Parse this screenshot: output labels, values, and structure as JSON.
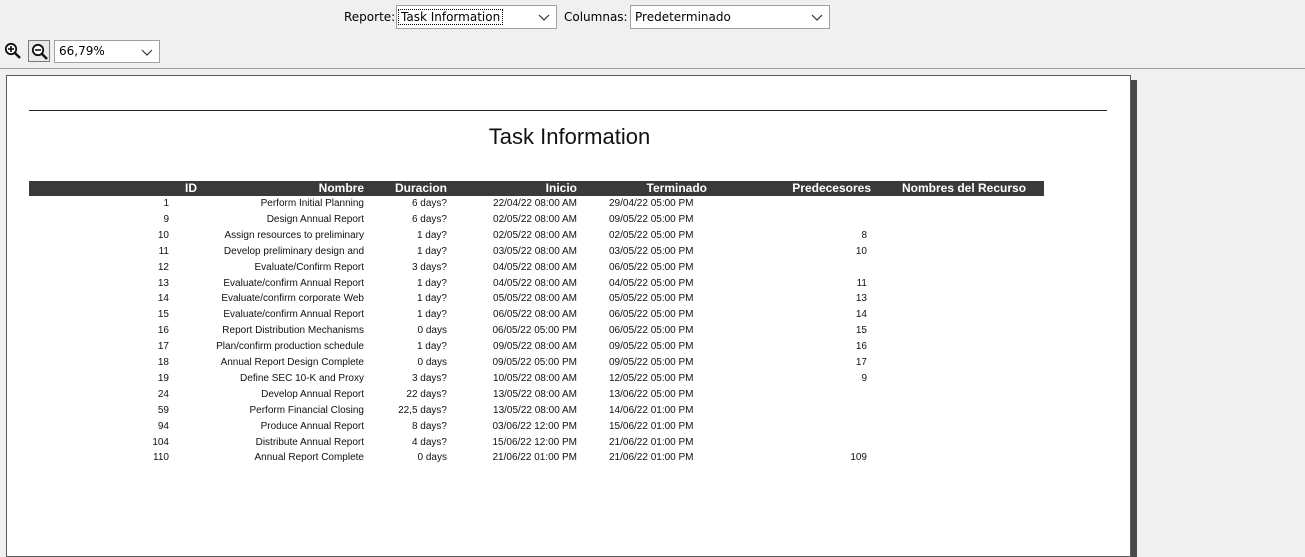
{
  "toolbar": {
    "report_label": "Reporte:",
    "report_value": "Task Information",
    "columns_label": "Columnas:",
    "columns_value": "Predeterminado",
    "zoom_value": "66,79%"
  },
  "report": {
    "title": "Task Information",
    "headers": {
      "id": "ID",
      "name": "Nombre",
      "duration": "Duracion",
      "start": "Inicio",
      "finish": "Terminado",
      "predecessors": "Predecesores",
      "resources": "Nombres del Recurso"
    },
    "rows": [
      {
        "id": "1",
        "name": "Perform Initial Planning",
        "duration": "6 days?",
        "start": "22/04/22 08:00 AM",
        "finish": "29/04/22 05:00 PM",
        "pred": ""
      },
      {
        "id": "9",
        "name": "Design Annual Report",
        "duration": "6 days?",
        "start": "02/05/22 08:00 AM",
        "finish": "09/05/22 05:00 PM",
        "pred": ""
      },
      {
        "id": "10",
        "name": "Assign resources to preliminary",
        "duration": "1 day?",
        "start": "02/05/22 08:00 AM",
        "finish": "02/05/22 05:00 PM",
        "pred": "8"
      },
      {
        "id": "11",
        "name": "Develop preliminary design and",
        "duration": "1 day?",
        "start": "03/05/22 08:00 AM",
        "finish": "03/05/22 05:00 PM",
        "pred": "10"
      },
      {
        "id": "12",
        "name": "Evaluate/Confirm Report",
        "duration": "3 days?",
        "start": "04/05/22 08:00 AM",
        "finish": "06/05/22 05:00 PM",
        "pred": ""
      },
      {
        "id": "13",
        "name": "Evaluate/confirm Annual Report",
        "duration": "1 day?",
        "start": "04/05/22 08:00 AM",
        "finish": "04/05/22 05:00 PM",
        "pred": "11"
      },
      {
        "id": "14",
        "name": "Evaluate/confirm corporate Web",
        "duration": "1 day?",
        "start": "05/05/22 08:00 AM",
        "finish": "05/05/22 05:00 PM",
        "pred": "13"
      },
      {
        "id": "15",
        "name": "Evaluate/confirm Annual Report",
        "duration": "1 day?",
        "start": "06/05/22 08:00 AM",
        "finish": "06/05/22 05:00 PM",
        "pred": "14"
      },
      {
        "id": "16",
        "name": "Report Distribution Mechanisms",
        "duration": "0 days",
        "start": "06/05/22 05:00 PM",
        "finish": "06/05/22 05:00 PM",
        "pred": "15"
      },
      {
        "id": "17",
        "name": "Plan/confirm production schedule",
        "duration": "1 day?",
        "start": "09/05/22 08:00 AM",
        "finish": "09/05/22 05:00 PM",
        "pred": "16"
      },
      {
        "id": "18",
        "name": "Annual Report Design Complete",
        "duration": "0 days",
        "start": "09/05/22 05:00 PM",
        "finish": "09/05/22 05:00 PM",
        "pred": "17"
      },
      {
        "id": "19",
        "name": "Define SEC 10-K and Proxy",
        "duration": "3 days?",
        "start": "10/05/22 08:00 AM",
        "finish": "12/05/22 05:00 PM",
        "pred": "9"
      },
      {
        "id": "24",
        "name": "Develop Annual Report",
        "duration": "22 days?",
        "start": "13/05/22 08:00 AM",
        "finish": "13/06/22 05:00 PM",
        "pred": ""
      },
      {
        "id": "59",
        "name": "Perform Financial Closing",
        "duration": "22,5 days?",
        "start": "13/05/22 08:00 AM",
        "finish": "14/06/22 01:00 PM",
        "pred": ""
      },
      {
        "id": "94",
        "name": "Produce Annual Report",
        "duration": "8 days?",
        "start": "03/06/22 12:00 PM",
        "finish": "15/06/22 01:00 PM",
        "pred": ""
      },
      {
        "id": "104",
        "name": "Distribute Annual Report",
        "duration": "4 days?",
        "start": "15/06/22 12:00 PM",
        "finish": "21/06/22 01:00 PM",
        "pred": ""
      },
      {
        "id": "110",
        "name": "Annual Report Complete",
        "duration": "0 days",
        "start": "21/06/22 01:00 PM",
        "finish": "21/06/22 01:00 PM",
        "pred": "109"
      }
    ]
  }
}
